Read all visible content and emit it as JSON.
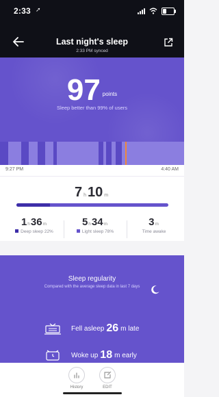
{
  "status_bar": {
    "time": "2:33",
    "location_glyph": "➚"
  },
  "nav": {
    "title": "Last night's sleep",
    "subtitle": "2:33 PM synced"
  },
  "score": {
    "value": "97",
    "unit": "points",
    "description": "Sleep better than 99% of users"
  },
  "timeline": {
    "start_label": "9:27 PM",
    "end_label": "4:40 AM",
    "current_marker_fraction": 0.68,
    "deep_segments": [
      [
        0.0,
        0.045
      ],
      [
        0.115,
        0.155
      ],
      [
        0.205,
        0.245
      ],
      [
        0.29,
        0.31
      ],
      [
        0.535,
        0.56
      ],
      [
        0.575,
        0.605
      ],
      [
        0.63,
        0.66
      ]
    ]
  },
  "duration": {
    "hours": "7",
    "hours_unit": "h",
    "minutes": "10",
    "minutes_unit": "m",
    "deep_fraction": 0.22,
    "stats": [
      {
        "value_h": "1",
        "value_m": "36",
        "label": "Deep sleep 22%",
        "color": "#3d2ea8"
      },
      {
        "value_h": "5",
        "value_m": "34",
        "label": "Light sleep 78%",
        "color": "#6553cc"
      },
      {
        "value_m": "3",
        "label": "Time awake",
        "color": ""
      }
    ]
  },
  "regularity": {
    "title": "Sleep regularity",
    "subtitle": "Compared with the average sleep data in last 7 days",
    "fell_asleep": {
      "prefix": "Fell asleep",
      "value": "26",
      "suffix": "m late"
    },
    "woke_up": {
      "prefix": "Woke up",
      "value": "18",
      "suffix": "m early"
    }
  },
  "bottom": {
    "history_label": "History",
    "edit_label": "EDIT"
  },
  "colors": {
    "header_bg": "#0f1017",
    "purple": "#6553cc",
    "deep": "#3d2ea8",
    "marker": "#f0883a"
  }
}
